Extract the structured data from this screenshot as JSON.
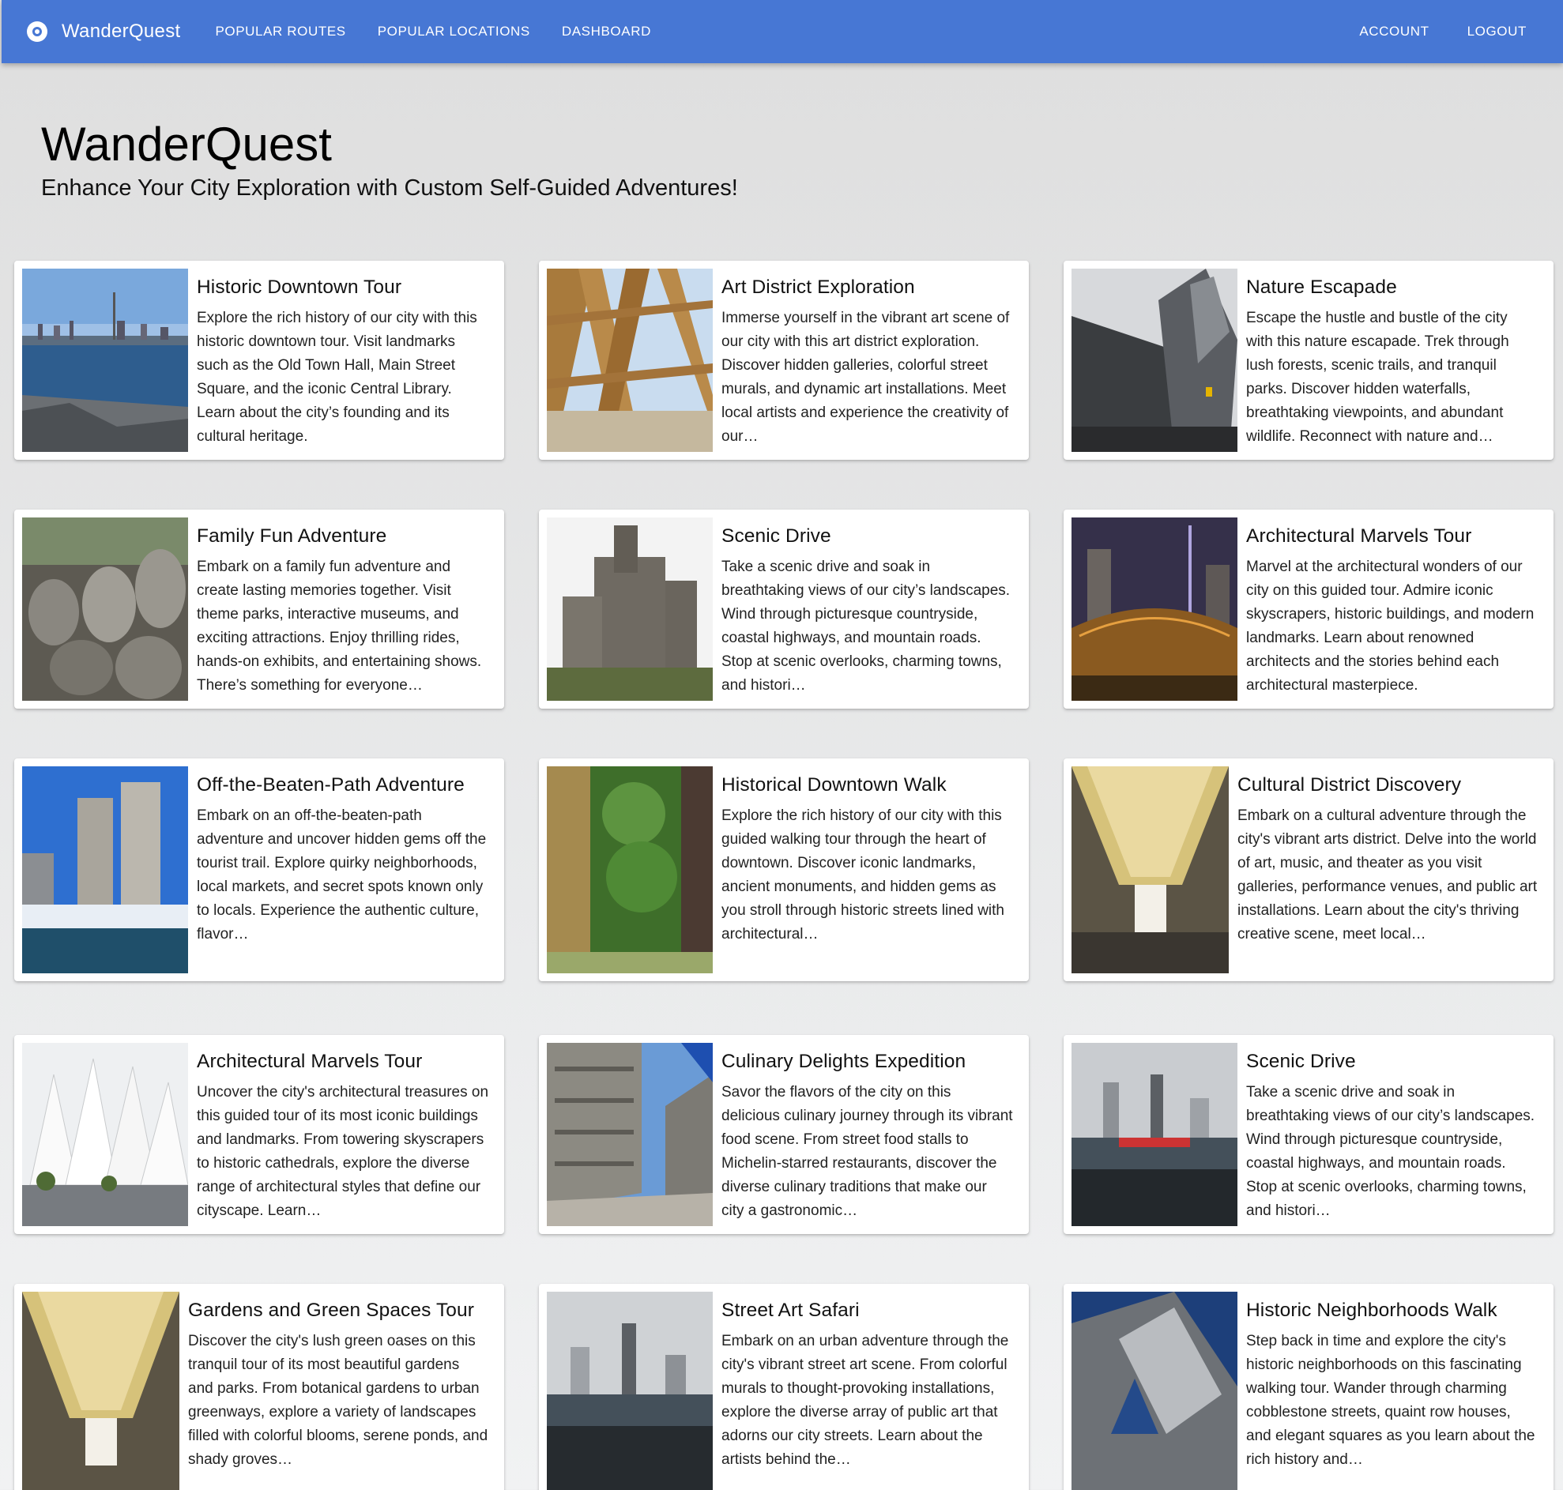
{
  "appbar": {
    "brand": "WanderQuest",
    "nav": [
      "POPULAR ROUTES",
      "POPULAR LOCATIONS",
      "DASHBOARD"
    ],
    "account": "ACCOUNT",
    "logout": "LOGOUT"
  },
  "hero": {
    "title": "WanderQuest",
    "subtitle": "Enhance Your City Exploration with Custom Self-Guided Adventures!"
  },
  "cards": [
    {
      "title": "Historic Downtown Tour",
      "text": "Explore the rich history of our city with this historic downtown tour. Visit landmarks such as the Old Town Hall, Main Street Square, and the iconic Central Library. Learn about the city’s founding and its cultural heritage."
    },
    {
      "title": "Art District Exploration",
      "text": "Immerse yourself in the vibrant art scene of our city with this art district exploration. Discover hidden galleries, colorful street murals, and dynamic art installations. Meet local artists and experience the creativity of our…"
    },
    {
      "title": "Nature Escapade",
      "text": "Escape the hustle and bustle of the city with this nature escapade. Trek through lush forests, scenic trails, and tranquil parks. Discover hidden waterfalls, breathtaking viewpoints, and abundant wildlife. Reconnect with nature and…"
    },
    {
      "title": "Family Fun Adventure",
      "text": "Embark on a family fun adventure and create lasting memories together. Visit theme parks, interactive museums, and exciting attractions. Enjoy thrilling rides, hands-on exhibits, and entertaining shows. There’s something for everyone…"
    },
    {
      "title": "Scenic Drive",
      "text": "Take a scenic drive and soak in breathtaking views of our city’s landscapes. Wind through picturesque countryside, coastal highways, and mountain roads. Stop at scenic overlooks, charming towns, and histori…"
    },
    {
      "title": "Architectural Marvels Tour",
      "text": "Marvel at the architectural wonders of our city on this guided tour. Admire iconic skyscrapers, historic buildings, and modern landmarks. Learn about renowned architects and the stories behind each architectural masterpiece."
    },
    {
      "title": "Off-the-Beaten-Path Adventure",
      "text": "Embark on an off-the-beaten-path adventure and uncover hidden gems off the tourist trail. Explore quirky neighborhoods, local markets, and secret spots known only to locals. Experience the authentic culture, flavor…"
    },
    {
      "title": "Historical Downtown Walk",
      "text": "Explore the rich history of our city with this guided walking tour through the heart of downtown. Discover iconic landmarks, ancient monuments, and hidden gems as you stroll through historic streets lined with architectural…"
    },
    {
      "title": "Cultural District Discovery",
      "text": "Embark on a cultural adventure through the city's vibrant arts district. Delve into the world of art, music, and theater as you visit galleries, performance venues, and public art installations. Learn about the city's thriving creative scene, meet local…"
    },
    {
      "title": "Architectural Marvels Tour",
      "text": "Uncover the city's architectural treasures on this guided tour of its most iconic buildings and landmarks. From towering skyscrapers to historic cathedrals, explore the diverse range of architectural styles that define our cityscape. Learn…"
    },
    {
      "title": "Culinary Delights Expedition",
      "text": "Savor the flavors of the city on this delicious culinary journey through its vibrant food scene. From street food stalls to Michelin-starred restaurants, discover the diverse culinary traditions that make our city a gastronomic…"
    },
    {
      "title": "Scenic Drive",
      "text": "Take a scenic drive and soak in breathtaking views of our city’s landscapes. Wind through picturesque countryside, coastal highways, and mountain roads. Stop at scenic overlooks, charming towns, and histori…"
    },
    {
      "title": "Gardens and Green Spaces Tour",
      "text": "Discover the city's lush green oases on this tranquil tour of its most beautiful gardens and parks. From botanical gardens to urban greenways, explore a variety of landscapes filled with colorful blooms, serene ponds, and shady groves…"
    },
    {
      "title": "Street Art Safari",
      "text": "Embark on an urban adventure through the city's vibrant street art scene. From colorful murals to thought-provoking installations, explore the diverse array of public art that adorns our city streets. Learn about the artists behind the…"
    },
    {
      "title": "Historic Neighborhoods Walk",
      "text": "Step back in time and explore the city's historic neighborhoods on this fascinating walking tour. Wander through charming cobblestone streets, quaint row houses, and elegant squares as you learn about the rich history and…"
    }
  ]
}
